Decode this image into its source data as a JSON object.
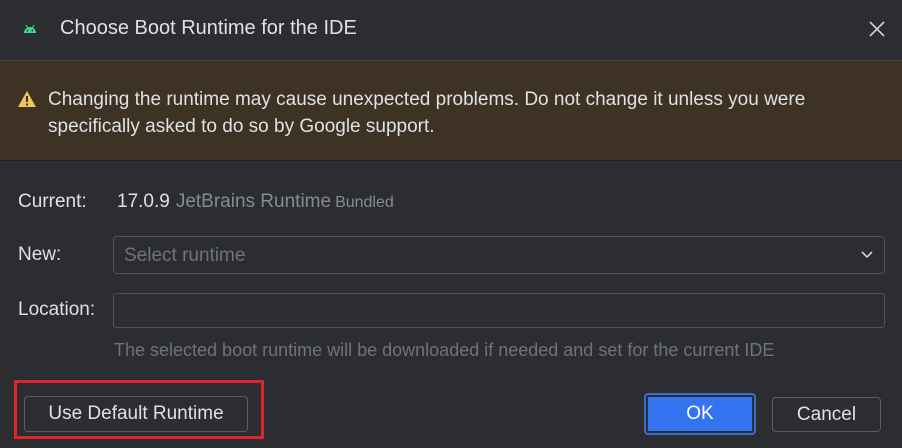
{
  "dialog": {
    "title": "Choose Boot Runtime for the IDE",
    "title_icon": "android-icon",
    "close_icon": "close-icon"
  },
  "warning": {
    "icon": "warning-icon",
    "text": "Changing the runtime may cause unexpected problems. Do not change it unless you were specifically asked to do so by Google support."
  },
  "form": {
    "current_label": "Current:",
    "current_version": "17.0.9",
    "current_vendor": "JetBrains Runtime",
    "current_tag": "Bundled",
    "new_label": "New:",
    "new_placeholder": "Select runtime",
    "location_label": "Location:",
    "location_value": "",
    "hint": "The selected boot runtime will be downloaded if needed and set for the current IDE"
  },
  "buttons": {
    "default_runtime": "Use Default Runtime",
    "ok": "OK",
    "cancel": "Cancel"
  },
  "colors": {
    "background": "#2b2d30",
    "banner": "#3d3223",
    "warning_icon": "#f2c55c",
    "accent": "#3574f0",
    "highlight": "#e0242c",
    "android_green": "#3ddc84"
  }
}
